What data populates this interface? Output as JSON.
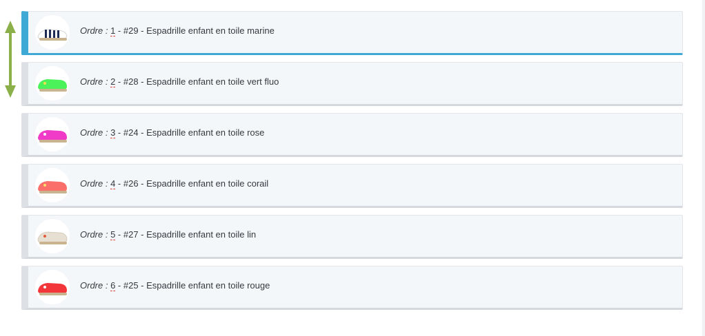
{
  "list": {
    "items": [
      {
        "prefix": "Ordre :",
        "num": "1",
        "text": " - #29 - Espadrille enfant en toile marine",
        "shoe_color": "#ffffff",
        "stripe_color": "#1f2a55",
        "icon": "espadrille-marine-thumbnail"
      },
      {
        "prefix": "Ordre :",
        "num": "2",
        "text": " - #28 - Espadrille enfant en toile vert fluo",
        "shoe_color": "#4cf25a",
        "stripe_color": "",
        "icon": "espadrille-vert-fluo-thumbnail"
      },
      {
        "prefix": "Ordre :",
        "num": "3",
        "text": " - #24 - Espadrille enfant en toile rose",
        "shoe_color": "#f03ac8",
        "stripe_color": "",
        "icon": "espadrille-rose-thumbnail"
      },
      {
        "prefix": "Ordre :",
        "num": "4",
        "text": " - #26 - Espadrille enfant en toile corail",
        "shoe_color": "#fb6f6a",
        "stripe_color": "",
        "icon": "espadrille-corail-thumbnail"
      },
      {
        "prefix": "Ordre :",
        "num": "5",
        "text": " - #27 - Espadrille enfant en toile lin",
        "shoe_color": "#e7e0d2",
        "stripe_color": "",
        "icon": "espadrille-lin-thumbnail"
      },
      {
        "prefix": "Ordre :",
        "num": "6",
        "text": " - #25 - Espadrille enfant en toile rouge",
        "shoe_color": "#f2363a",
        "stripe_color": "",
        "icon": "espadrille-rouge-thumbnail"
      }
    ]
  },
  "colors": {
    "accent": "#3fa9d6",
    "drag_arrow": "#8bb04a",
    "row_background": "#f4f7fa",
    "underline": "#d9534f"
  }
}
